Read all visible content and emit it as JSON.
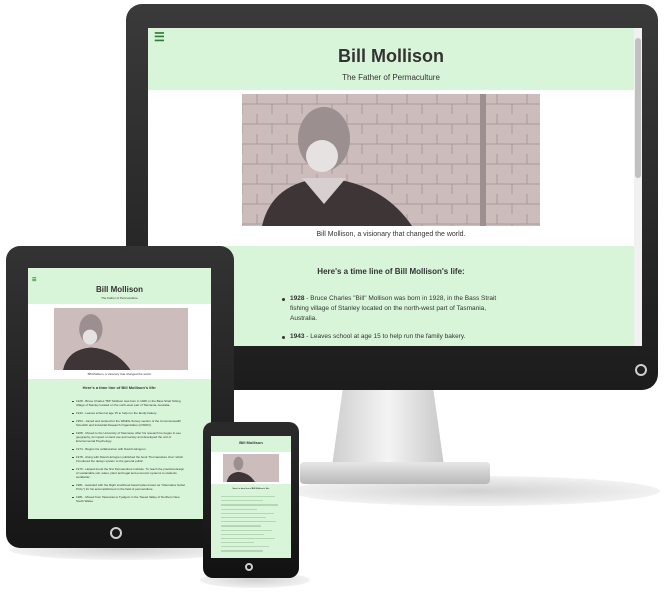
{
  "desktop": {
    "title": "Bill Mollison",
    "subtitle": "The Father of Permaculture",
    "caption": "Bill Mollison, a visionary that changed the world.",
    "timeline_heading": "Here's a time line of Bill Mollison's life:",
    "timeline_items": [
      {
        "year": "1928",
        "text": " - Bruce Charles \"Bill\" Mollison was born in 1928, in the Bass Strait fishing village of Stanley located on the north-west part of Tasmania, Australia."
      },
      {
        "year": "1943",
        "text": " - Leaves school at age 15 to help run the family bakery."
      }
    ],
    "menu_icon": "hamburger-icon"
  },
  "tablet": {
    "title": "Bill Mollison",
    "subtitle": "The Father of Permaculture",
    "caption": "Bill Mollison, a visionary that changed the world.",
    "timeline_heading": "Here's a time line of Bill Mollison's life:",
    "timeline_items": [
      "1928 - Bruce Charles \"Bill\" Mollison was born in 1928, in the Bass Strait fishing village of Stanley located on the north-west part of Tasmania, Australia.",
      "1943 - Leaves school at age 15 to help run the family bakery.",
      "1954 - Joined and worked for the Wildlife Survey section of the Commonwealth Scientific and Industrial Research Organization (CSIRO).",
      "1968 - Moved to the University of Tasmania. After his research he began to see geography, its impact on land use and society and developed the unit of Environmental Psychology.",
      "1974 - Begins his collaboration with David Holmgren.",
      "1978 - Along with David Holmgren published the book \"Permaculture One\" which introduced the design system to the general public.",
      "1979 - Helped found the first Permaculture Institute. To 'teach the practical design of sustainable soil, water, plant and legal and economic systems to students worldwide'.",
      "1981 - Awarded with the Right Livelihood Award (also known as \"Alternative Nobel Prize\") for his accomplishment in the field of permaculture.",
      "1981 - Moved from Tasmania to Tyalgum in the Tweed Valley of Northern New South Wales."
    ],
    "menu_icon": "hamburger-icon"
  },
  "phone": {
    "title": "Bill Mollison",
    "timeline_heading": "Here's a time line of Bill Mollison's life:"
  },
  "colors": {
    "header_bg": "#d9f5d9",
    "menu_green": "#2e7d32",
    "bezel": "#1c1c1c"
  }
}
